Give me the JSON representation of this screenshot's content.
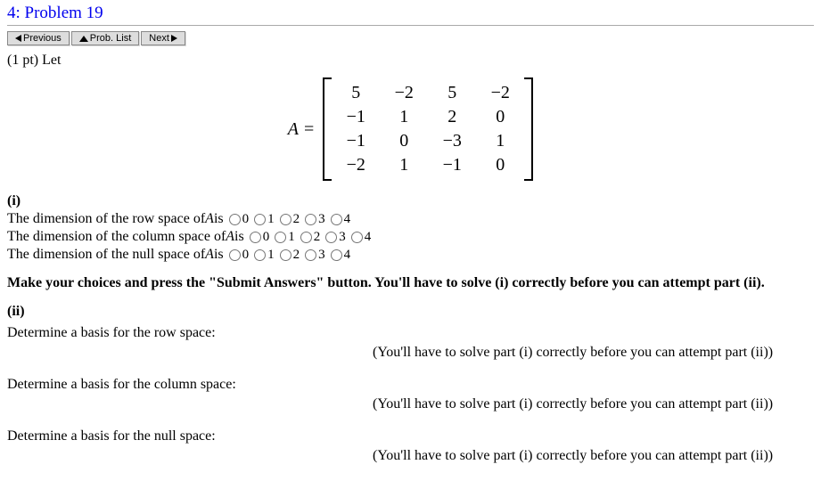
{
  "title": "4: Problem 19",
  "nav": {
    "previous": "Previous",
    "problist": "Prob. List",
    "next": "Next"
  },
  "intro": {
    "points": "(1 pt)",
    "let": "Let"
  },
  "matrix": {
    "lhs": "A",
    "eq": "=",
    "rows": [
      [
        "5",
        "−2",
        "5",
        "−2"
      ],
      [
        "−1",
        "1",
        "2",
        "0"
      ],
      [
        "−1",
        "0",
        "−3",
        "1"
      ],
      [
        "−2",
        "1",
        "−1",
        "0"
      ]
    ]
  },
  "part_i": {
    "label": "(i)",
    "row_text_pre": "The dimension of the row space of ",
    "row_text_A": "A",
    "row_text_post": " is ",
    "col_text_pre": "The dimension of the column space of ",
    "null_text_pre": "The dimension of the null space of ",
    "options": [
      "0",
      "1",
      "2",
      "3",
      "4"
    ]
  },
  "instruction": "Make your choices and press the \"Submit Answers\" button. You'll have to solve (i) correctly before you can attempt part (ii).",
  "part_ii": {
    "label": "(ii)",
    "row_basis": "Determine a basis for the row space:",
    "col_basis": "Determine a basis for the column space:",
    "null_basis": "Determine a basis for the null space:",
    "locked_msg": "(You'll have to solve part (i) correctly before you can attempt part (ii))"
  }
}
